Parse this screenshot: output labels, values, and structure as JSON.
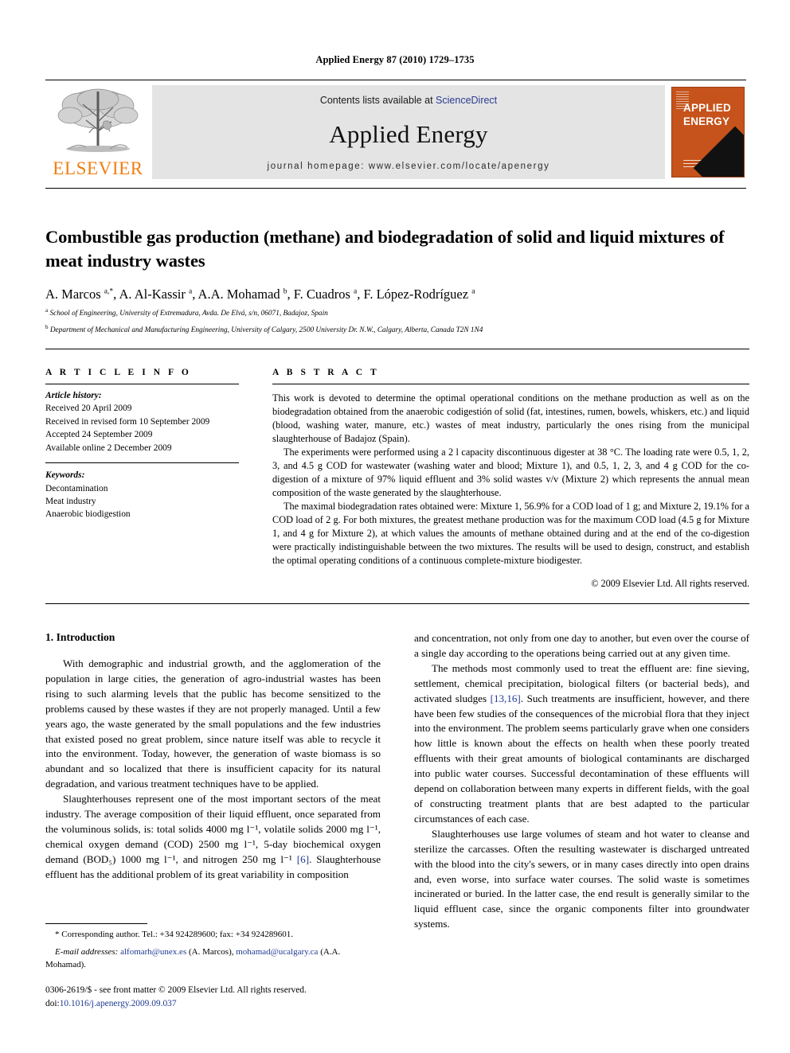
{
  "running_head": "Applied Energy 87 (2010) 1729–1735",
  "masthead": {
    "publisher_name": "ELSEVIER",
    "contents_prefix": "Contents lists available at ",
    "contents_link": "ScienceDirect",
    "journal_title": "Applied Energy",
    "homepage_label": "journal homepage: www.elsevier.com/locate/apenergy",
    "cover_line1": "APPLIED",
    "cover_line2": "ENERGY",
    "accent_orange": "#F07E12",
    "cover_orange": "#C6531B",
    "link_blue": "#2a3b8f"
  },
  "article": {
    "title": "Combustible gas production (methane) and biodegradation of solid and liquid mixtures of meat industry wastes",
    "authors_html": "A. Marcos <sup>a,*</sup>, A. Al-Kassir <sup>a</sup>, A.A. Mohamad <sup>b</sup>, F. Cuadros <sup>a</sup>, F. López-Rodríguez <sup>a</sup>",
    "affiliation_a": "School of Engineering, University of Extremadura, Avda. De Elvá, s/n, 06071, Badajoz, Spain",
    "affiliation_b": "Department of Mechanical and Manufacturing Engineering, University of Calgary, 2500 University Dr. N.W., Calgary, Alberta, Canada T2N 1N4"
  },
  "info": {
    "heading": "A R T I C L E   I N F O",
    "history_label": "Article history:",
    "history": [
      "Received 20 April 2009",
      "Received in revised form 10 September 2009",
      "Accepted 24 September 2009",
      "Available online 2 December 2009"
    ],
    "keywords_label": "Keywords:",
    "keywords": [
      "Decontamination",
      "Meat industry",
      "Anaerobic biodigestion"
    ]
  },
  "abstract": {
    "heading": "A B S T R A C T",
    "paragraphs": [
      "This work is devoted to determine the optimal operational conditions on the methane production as well as on the biodegradation obtained from the anaerobic codigestión of solid (fat, intestines, rumen, bowels, whiskers, etc.) and liquid (blood, washing water, manure, etc.) wastes of meat industry, particularly the ones rising from the municipal slaughterhouse of Badajoz (Spain).",
      "The experiments were performed using a 2 l capacity discontinuous digester at 38 °C. The loading rate were 0.5, 1, 2, 3, and 4.5 g COD for wastewater (washing water and blood; Mixture 1), and 0.5, 1, 2, 3, and 4 g COD for the co-digestion of a mixture of 97% liquid effluent and 3% solid wastes v/v (Mixture 2) which represents the annual mean composition of the waste generated by the slaughterhouse.",
      "The maximal biodegradation rates obtained were: Mixture 1, 56.9% for a COD load of 1 g; and Mixture 2, 19.1% for a COD load of 2 g. For both mixtures, the greatest methane production was for the maximum COD load (4.5 g for Mixture 1, and 4 g for Mixture 2), at which values the amounts of methane obtained during and at the end of the co-digestion were practically indistinguishable between the two mixtures. The results will be used to design, construct, and establish the optimal operating conditions of a continuous complete-mixture biodigester."
    ],
    "copyright": "© 2009 Elsevier Ltd. All rights reserved."
  },
  "body": {
    "section_number_title": "1. Introduction",
    "left_paragraphs": [
      "With demographic and industrial growth, and the agglomeration of the population in large cities, the generation of agro-industrial wastes has been rising to such alarming levels that the public has become sensitized to the problems caused by these wastes if they are not properly managed. Until a few years ago, the waste generated by the small populations and the few industries that existed posed no great problem, since nature itself was able to recycle it into the environment. Today, however, the generation of waste biomass is so abundant and so localized that there is insufficient capacity for its natural degradation, and various treatment techniques have to be applied."
    ],
    "left_paragraph_2_parts": {
      "before_ref": "Slaughterhouses represent one of the most important sectors of the meat industry. The average composition of their liquid effluent, once separated from the voluminous solids, is: total solids 4000 mg l⁻¹, volatile solids 2000 mg l⁻¹, chemical oxygen demand (COD) 2500 mg l⁻¹, 5-day biochemical oxygen demand (BOD₅) 1000 mg l⁻¹, and nitrogen 250 mg l⁻¹ ",
      "ref": "[6]",
      "after_ref": ". Slaughterhouse effluent has the additional problem of its great variability in composition"
    },
    "right_paragraph_1": "and concentration, not only from one day to another, but even over the course of a single day according to the operations being carried out at any given time.",
    "right_paragraph_2_parts": {
      "before_ref": "The methods most commonly used to treat the effluent are: fine sieving, settlement, chemical precipitation, biological filters (or bacterial beds), and activated sludges ",
      "ref": "[13,16]",
      "after_ref": ". Such treatments are insufficient, however, and there have been few studies of the consequences of the microbial flora that they inject into the environment. The problem seems particularly grave when one considers how little is known about the effects on health when these poorly treated effluents with their great amounts of biological contaminants are discharged into public water courses. Successful decontamination of these effluents will depend on collaboration between many experts in different fields, with the goal of constructing treatment plants that are best adapted to the particular circumstances of each case."
    },
    "right_paragraph_3": "Slaughterhouses use large volumes of steam and hot water to cleanse and sterilize the carcasses. Often the resulting wastewater is discharged untreated with the blood into the city's sewers, or in many cases directly into open drains and, even worse, into surface water courses. The solid waste is sometimes incinerated or buried. In the latter case, the end result is generally similar to the liquid effluent case, since the organic components filter into groundwater systems."
  },
  "footnote": {
    "corresponding": "Corresponding author. Tel.: +34 924289600; fax: +34 924289601.",
    "email_label": "E-mail addresses:",
    "email_1": "alfomarh@unex.es",
    "email_1_owner": " (A. Marcos), ",
    "email_2": "mohamad@ucalgary.ca",
    "email_2_owner": " (A.A. Mohamad)."
  },
  "imprint": {
    "issn_line": "0306-2619/$ - see front matter © 2009 Elsevier Ltd. All rights reserved.",
    "doi_label": "doi:",
    "doi_value": "10.1016/j.apenergy.2009.09.037"
  }
}
